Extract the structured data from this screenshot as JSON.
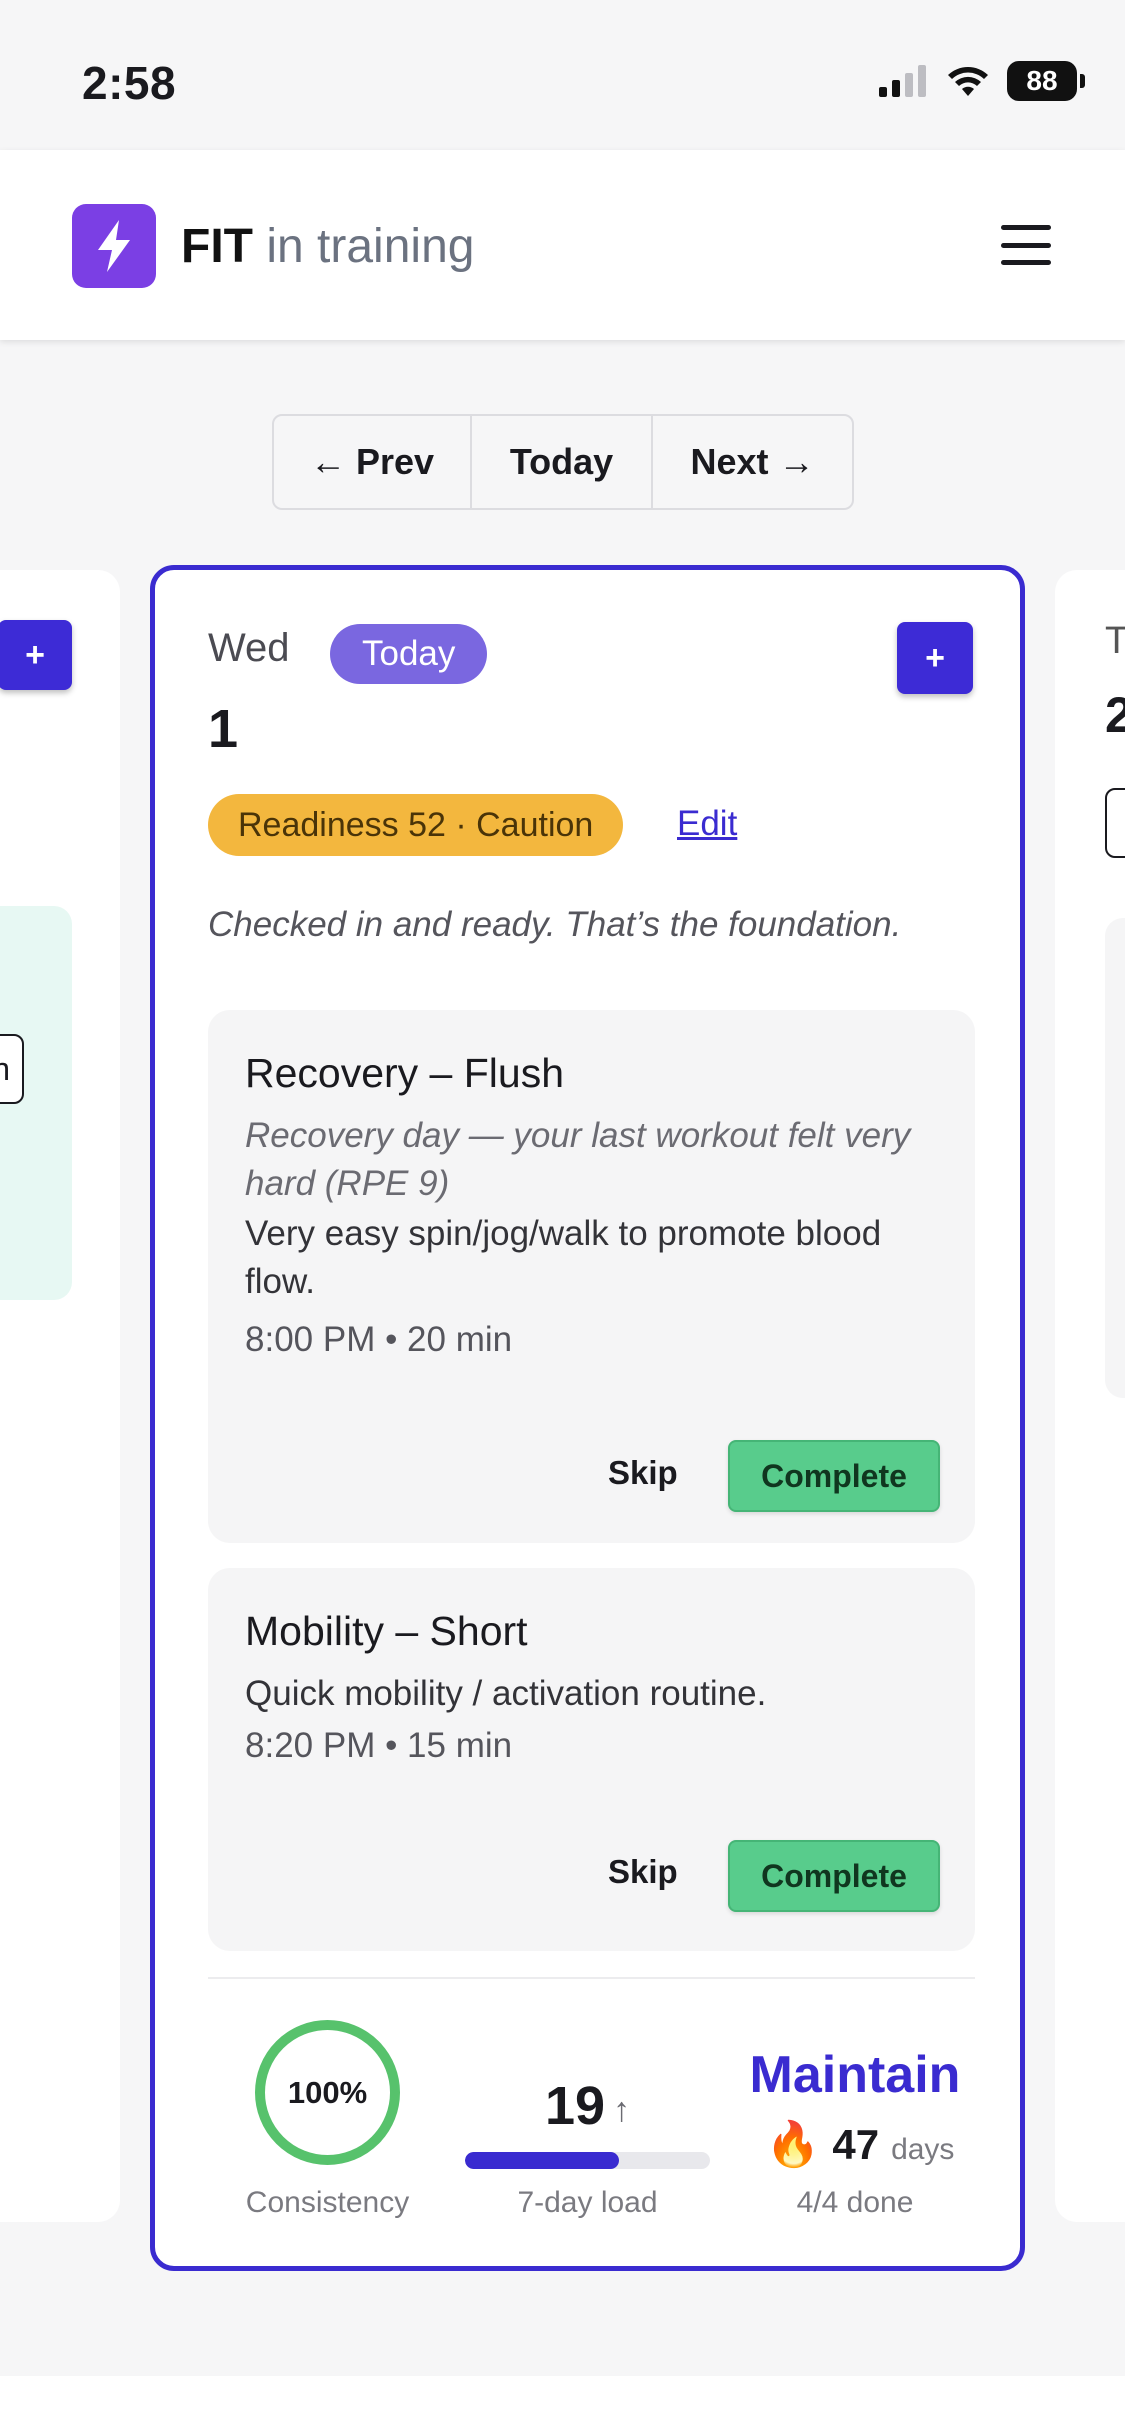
{
  "status_bar": {
    "time": "2:58",
    "battery": "88",
    "icons": [
      "cellular-signal-icon",
      "wifi-icon",
      "battery-icon"
    ]
  },
  "header": {
    "brand_bold": "FIT",
    "brand_light": "in training",
    "logo_icon": "lightning-bolt-icon",
    "logo_color": "#7b3fe4",
    "menu_icon": "hamburger-menu-icon"
  },
  "date_nav": {
    "prev": "← Prev",
    "today": "Today",
    "next": "Next →"
  },
  "left_card": {
    "plus": "+",
    "chip_text": "n"
  },
  "day": {
    "dow": "Wed",
    "today_badge": "Today",
    "number": "1",
    "add_button": "+",
    "readiness": "Readiness 52 · Caution",
    "edit": "Edit",
    "motto": "Checked in and ready. That’s the foundation.",
    "workouts": [
      {
        "title": "Recovery – Flush",
        "note": "Recovery day — your last workout felt very hard (RPE 9)",
        "description": "Very easy spin/jog/walk to promote blood flow.",
        "meta": "8:00 PM • 20 min",
        "skip": "Skip",
        "complete": "Complete"
      },
      {
        "title": "Mobility – Short",
        "description": "Quick mobility / activation routine.",
        "meta": "8:20 PM • 15 min",
        "skip": "Skip",
        "complete": "Complete"
      }
    ],
    "stats": {
      "consistency_value": "100%",
      "consistency_label": "Consistency",
      "load_value": "19",
      "load_arrow": "↑",
      "load_label": "7-day load",
      "load_fill_fraction": 0.63,
      "status": "Maintain",
      "streak_icon": "flame-icon",
      "streak_value": "47",
      "streak_unit": "days",
      "done_label": "4/4 done"
    }
  },
  "right_card": {
    "dow": "T",
    "number": "2"
  },
  "colors": {
    "accent": "#3a2bd0",
    "readiness_caution": "#f3b73e",
    "complete_green": "#58cc8c",
    "consistency_ring": "#57c26c"
  }
}
